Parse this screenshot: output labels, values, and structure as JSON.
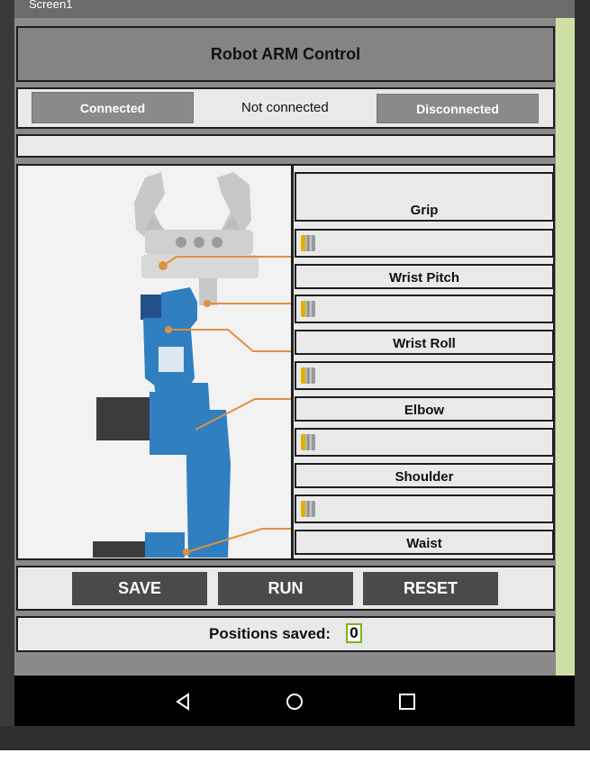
{
  "window": {
    "title": "Screen1"
  },
  "header": {
    "title": "Robot ARM Control"
  },
  "connection": {
    "connect_button": "Connected",
    "status_text": "Not connected",
    "disconnect_button": "Disconnected"
  },
  "joints": [
    {
      "label": "Grip"
    },
    {
      "label": "Wrist Pitch"
    },
    {
      "label": "Wrist Roll"
    },
    {
      "label": "Elbow"
    },
    {
      "label": "Shoulder"
    },
    {
      "label": "Waist"
    }
  ],
  "actions": {
    "save": "SAVE",
    "run": "RUN",
    "reset": "RESET"
  },
  "positions": {
    "label": "Positions saved:",
    "count": "0"
  },
  "colors": {
    "arm_blue": "#2f7fc1",
    "gripper_gray": "#c8c8c8",
    "motor_black": "#3c3c3c",
    "connector_orange": "#e09040",
    "accent_green": "#7ab51d"
  },
  "navigation": {
    "icons": [
      "back-icon",
      "home-icon",
      "recents-icon"
    ]
  }
}
